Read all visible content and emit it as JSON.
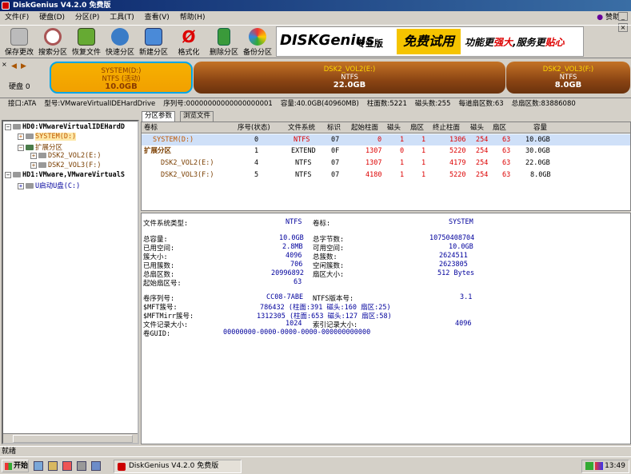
{
  "window": {
    "title": "DiskGenius V4.2.0 免费版"
  },
  "menu": [
    "文件(F)",
    "硬盘(D)",
    "分区(P)",
    "工具(T)",
    "查看(V)",
    "帮助(H)"
  ],
  "donate": "赞助",
  "toolbar": [
    "保存更改",
    "搜索分区",
    "恢复文件",
    "快速分区",
    "新建分区",
    "格式化",
    "删除分区",
    "备份分区"
  ],
  "banner": {
    "logo": "DISKGenius",
    "edition": "专业版",
    "promo1": "免费试用",
    "promo2a": "功能更",
    "promo2b": "强大",
    "promo2c": ",服务更",
    "promo2d": "贴心"
  },
  "diskbar": {
    "label": "硬盘 0",
    "partitions": [
      {
        "name": "SYSTEM(D:)",
        "fs": "NTFS (活动)",
        "size": "10.0GB"
      },
      {
        "name": "DSK2_VOL2(E:)",
        "fs": "NTFS",
        "size": "22.0GB"
      },
      {
        "name": "DSK2_VOL3(F:)",
        "fs": "NTFS",
        "size": "8.0GB"
      }
    ]
  },
  "diskinfo": {
    "iface": "接口:ATA",
    "model": "型号:VMwareVirtualIDEHardDrive",
    "serial": "序列号:00000000000000000001",
    "capacity": "容量:40.0GB(40960MB)",
    "cyl": "柱面数:5221",
    "heads": "磁头数:255",
    "spt": "每道扇区数:63",
    "total": "总扇区数:83886080"
  },
  "tree": {
    "hd0": "HD0:VMwareVirtualIDEHardD",
    "system": "SYSTEM(D:)",
    "ext": "扩展分区",
    "vol2": "DSK2_VOL2(E:)",
    "vol3": "DSK2_VOL3(F:)",
    "hd1": "HD1:VMware,VMwareVirtualS",
    "usb": "U启动U盘(C:)"
  },
  "tabs": [
    "分区参数",
    "浏览文件"
  ],
  "grid": {
    "headers": [
      "卷标",
      "序号(状态)",
      "文件系统",
      "标识",
      "起始柱面",
      "磁头",
      "扇区",
      "终止柱面",
      "磁头",
      "扇区",
      "容量"
    ],
    "rows": [
      [
        "SYSTEM(D:)",
        "0",
        "NTFS",
        "07",
        "0",
        "1",
        "1",
        "1306",
        "254",
        "63",
        "10.0GB"
      ],
      [
        "扩展分区",
        "1",
        "EXTEND",
        "0F",
        "1307",
        "0",
        "1",
        "5220",
        "254",
        "63",
        "30.0GB"
      ],
      [
        "DSK2_VOL2(E:)",
        "4",
        "NTFS",
        "07",
        "1307",
        "1",
        "1",
        "4179",
        "254",
        "63",
        "22.0GB"
      ],
      [
        "DSK2_VOL3(F:)",
        "5",
        "NTFS",
        "07",
        "4180",
        "1",
        "1",
        "5220",
        "254",
        "63",
        "8.0GB"
      ]
    ]
  },
  "details": {
    "fstype_l": "文件系统类型:",
    "fstype_v": "NTFS",
    "vol_l": "卷标:",
    "vol_v": "SYSTEM",
    "cap_l": "总容量:",
    "cap_v": "10.0GB",
    "bytes_l": "总字节数:",
    "bytes_v": "10750408704",
    "used_l": "已用空间:",
    "used_v": "2.8MB",
    "free_l": "可用空间:",
    "free_v": "10.0GB",
    "clsz_l": "簇大小:",
    "clsz_v": "4096",
    "clus_l": "总簇数:",
    "clus_v": "2624511",
    "ucl_l": "已用簇数:",
    "ucl_v": "706",
    "fcl_l": "空闲簇数:",
    "fcl_v": "2623805",
    "sect_l": "总扇区数:",
    "sect_v": "20996892",
    "secsz_l": "扇区大小:",
    "secsz_v": "512 Bytes",
    "start_l": "起始扇区号:",
    "start_v": "63",
    "serial_l": "卷序列号:",
    "serial_v": "CC08-7ABE",
    "ver_l": "NTFS版本号:",
    "ver_v": "3.1",
    "mft_l": "$MFT簇号:",
    "mft_v": "786432 (柱面:391 磁头:160 扇区:25)",
    "mftm_l": "$MFTMirr簇号:",
    "mftm_v": "1312305 (柱面:653 磁头:127 扇区:58)",
    "frs_l": "文件记录大小:",
    "frs_v": "1024",
    "idx_l": "索引记录大小:",
    "idx_v": "4096",
    "guid_l": "卷GUID:",
    "guid_v": "00000000-0000-0000-0000-000000000000"
  },
  "status": "就绪",
  "taskbar": {
    "start": "开始",
    "task": "DiskGenius V4.2.0 免费版",
    "clock": "13:49"
  }
}
